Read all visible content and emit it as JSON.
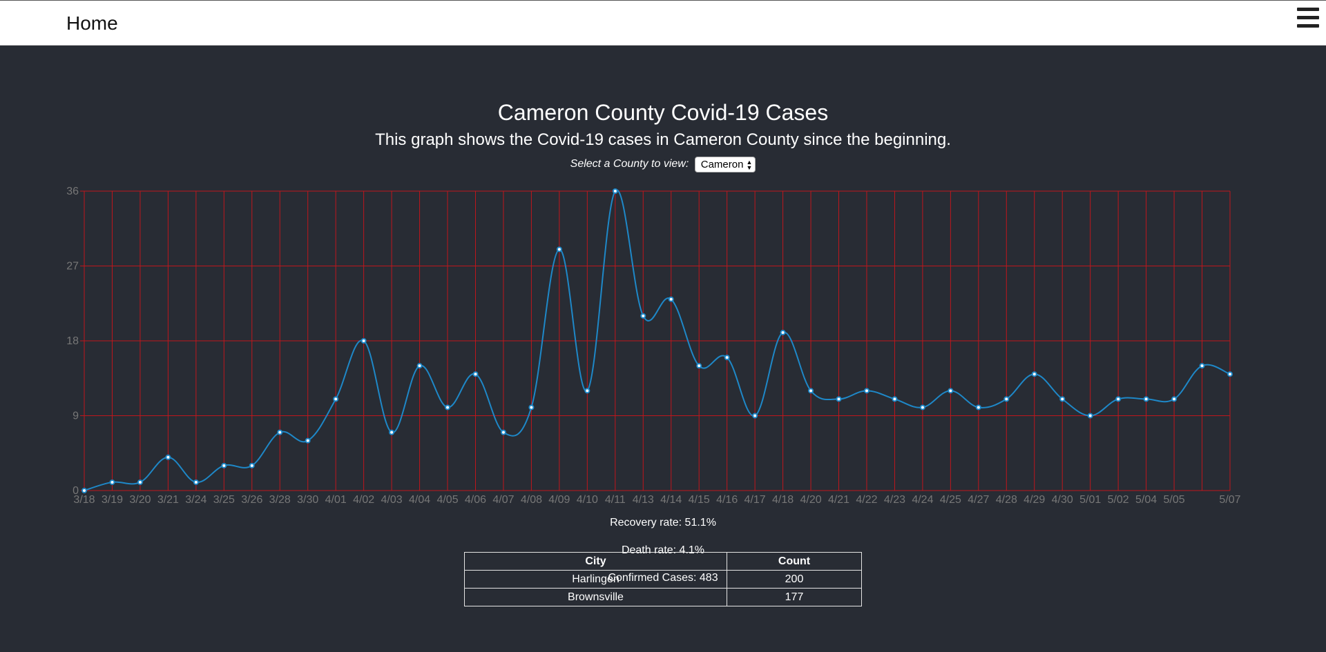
{
  "nav": {
    "brand": "Home",
    "menu_icon": "hamburger-menu-icon"
  },
  "page": {
    "title": "Cameron County Covid-19 Cases",
    "subtitle": "This graph shows the Covid-19 cases in Cameron County since the beginning.",
    "county_label": "Select a County to view:",
    "county_selected": "Cameron"
  },
  "chart_data": {
    "type": "line",
    "title": "",
    "xlabel": "",
    "ylabel": "",
    "ylim": [
      0,
      36
    ],
    "yticks": [
      0,
      9,
      18,
      27,
      36
    ],
    "grid": true,
    "grid_color": "#c0161c",
    "line_color": "#1e88c8",
    "categories": [
      "3/18",
      "3/19",
      "3/20",
      "3/21",
      "3/24",
      "3/25",
      "3/26",
      "3/28",
      "3/30",
      "4/01",
      "4/02",
      "4/03",
      "4/04",
      "4/05",
      "4/06",
      "4/07",
      "4/08",
      "4/09",
      "4/10",
      "4/11",
      "4/13",
      "4/14",
      "4/15",
      "4/16",
      "4/17",
      "4/18",
      "4/20",
      "4/21",
      "4/22",
      "4/23",
      "4/24",
      "4/25",
      "4/27",
      "4/28",
      "4/29",
      "4/30",
      "5/01",
      "5/02",
      "5/04",
      "5/05",
      "",
      "5/07"
    ],
    "values": [
      0,
      1,
      1,
      4,
      1,
      3,
      3,
      7,
      6,
      11,
      18,
      7,
      15,
      10,
      14,
      7,
      10,
      29,
      12,
      36,
      21,
      23,
      15,
      16,
      9,
      19,
      12,
      11,
      12,
      11,
      10,
      12,
      10,
      11,
      14,
      11,
      9,
      11,
      11,
      11,
      15,
      14
    ]
  },
  "stats": {
    "recovery": "Recovery rate: 51.1%",
    "death": "Death rate: 4.1%",
    "confirmed": "Confirmed Cases: 483"
  },
  "city_table": {
    "headers": [
      "City",
      "Count"
    ],
    "rows": [
      [
        "Harlingen",
        "200"
      ],
      [
        "Brownsville",
        "177"
      ]
    ]
  }
}
